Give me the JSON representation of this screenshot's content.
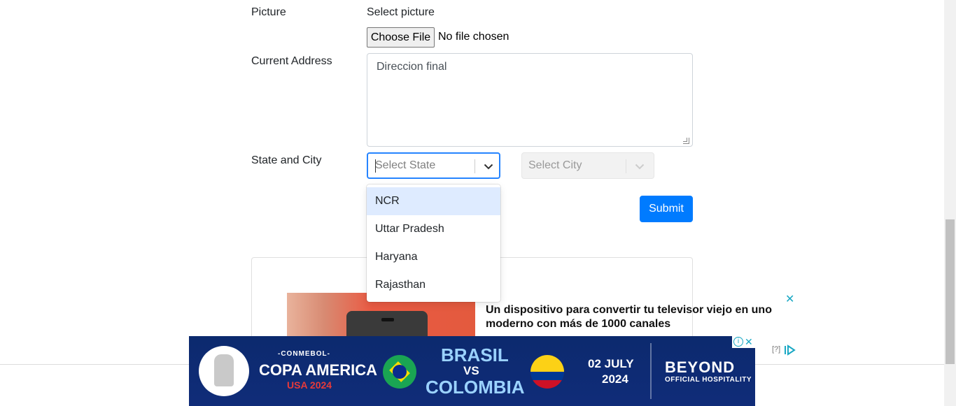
{
  "form": {
    "picture_label": "Picture",
    "select_picture_text": "Select picture",
    "choose_file_label": "Choose File",
    "no_file_text": "No file chosen",
    "address_label": "Current Address",
    "address_value": "Direccion final",
    "state_city_label": "State and City",
    "state_placeholder": "Select State",
    "city_placeholder": "Select City",
    "submit_label": "Submit"
  },
  "state_menu": {
    "options": [
      "NCR",
      "Uttar Pradesh",
      "Haryana",
      "Rajasthan"
    ],
    "focused_index": 0
  },
  "ad": {
    "title": "Un dispositivo para convertir tu televisor viejo en uno moderno con más de 1000 canales",
    "close_icon": "✕",
    "info_text": "[?]"
  },
  "banner": {
    "conmebol": "-CONMEBOL-",
    "copa": "COPA AMERICA",
    "usa": "USA 2024",
    "team1": "BRASIL",
    "vs": "VS",
    "team2": "COLOMBIA",
    "date_line1": "02 JULY",
    "date_line2": "2024",
    "sponsor": "BEYOND",
    "sponsor_sub": "OFFICIAL HOSPITALITY",
    "adchoice_i": "i",
    "adchoice_x": "✕"
  },
  "colors": {
    "primary": "#007bff",
    "focus_border": "#2684ff",
    "option_focus": "#deebff"
  }
}
